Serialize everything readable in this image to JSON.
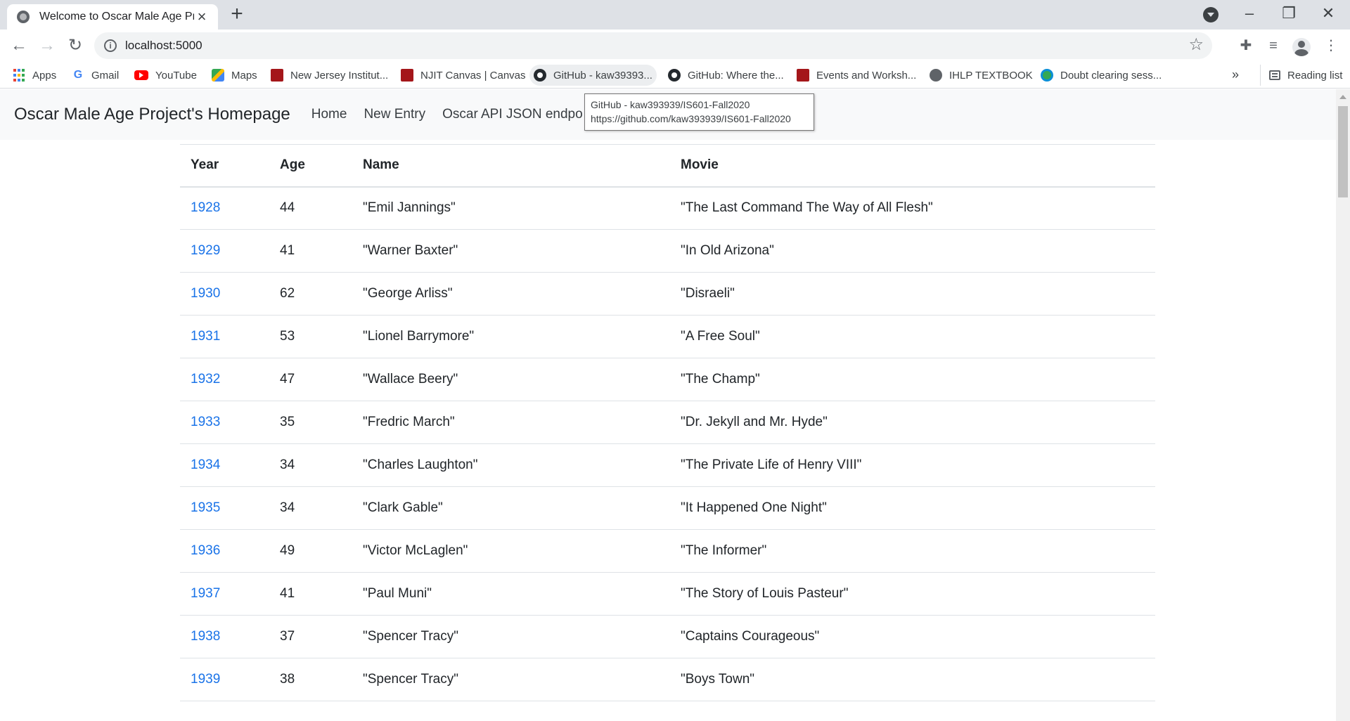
{
  "browser": {
    "tab_title": "Welcome to Oscar Male Age Proj",
    "url": "localhost:5000",
    "bookmarks": [
      {
        "label": "Apps",
        "icon": "apps-icon"
      },
      {
        "label": "Gmail",
        "icon": "google-icon"
      },
      {
        "label": "YouTube",
        "icon": "youtube-icon"
      },
      {
        "label": "Maps",
        "icon": "maps-icon"
      },
      {
        "label": "New Jersey Institut...",
        "icon": "njit-icon"
      },
      {
        "label": "NJIT Canvas | Canvas",
        "icon": "njit-icon"
      },
      {
        "label": "GitHub - kaw39393...",
        "icon": "github-icon"
      },
      {
        "label": "GitHub: Where the...",
        "icon": "github-icon"
      },
      {
        "label": "Events and Worksh...",
        "icon": "njit-icon"
      },
      {
        "label": "IHLP TEXTBOOK",
        "icon": "globe-icon"
      },
      {
        "label": "Doubt clearing sess...",
        "icon": "doubt-icon"
      }
    ],
    "more_bookmarks": "»",
    "reading_list": "Reading list",
    "tooltip": {
      "title": "GitHub - kaw393939/IS601-Fall2020",
      "url": "https://github.com/kaw393939/IS601-Fall2020"
    }
  },
  "site": {
    "brand": "Oscar Male Age Project's Homepage",
    "nav": [
      "Home",
      "New Entry",
      "Oscar API JSON endpo"
    ]
  },
  "table": {
    "headers": [
      "Year",
      "Age",
      "Name",
      "Movie"
    ],
    "rows": [
      [
        "1928",
        "44",
        "\"Emil Jannings\"",
        "\"The Last Command The Way of All Flesh\""
      ],
      [
        "1929",
        "41",
        "\"Warner Baxter\"",
        "\"In Old Arizona\""
      ],
      [
        "1930",
        "62",
        "\"George Arliss\"",
        "\"Disraeli\""
      ],
      [
        "1931",
        "53",
        "\"Lionel Barrymore\"",
        "\"A Free Soul\""
      ],
      [
        "1932",
        "47",
        "\"Wallace Beery\"",
        "\"The Champ\""
      ],
      [
        "1933",
        "35",
        "\"Fredric March\"",
        "\"Dr. Jekyll and Mr. Hyde\""
      ],
      [
        "1934",
        "34",
        "\"Charles Laughton\"",
        "\"The Private Life of Henry VIII\""
      ],
      [
        "1935",
        "34",
        "\"Clark Gable\"",
        "\"It Happened One Night\""
      ],
      [
        "1936",
        "49",
        "\"Victor McLaglen\"",
        "\"The Informer\""
      ],
      [
        "1937",
        "41",
        "\"Paul Muni\"",
        "\"The Story of Louis Pasteur\""
      ],
      [
        "1938",
        "37",
        "\"Spencer Tracy\"",
        "\"Captains Courageous\""
      ],
      [
        "1939",
        "38",
        "\"Spencer Tracy\"",
        "\"Boys Town\""
      ]
    ]
  },
  "colors": {
    "link": "#1a73e8",
    "navbar_bg": "#f8f9fa",
    "tabstrip_bg": "#dee1e6"
  }
}
